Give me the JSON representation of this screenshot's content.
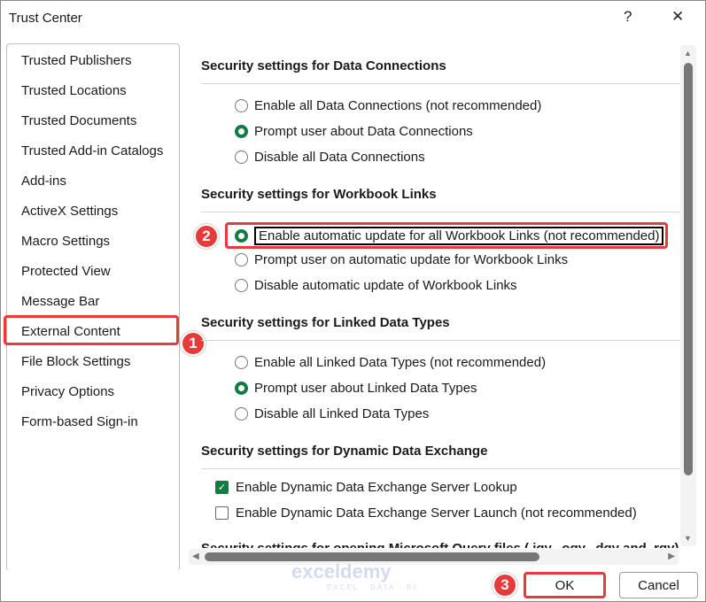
{
  "window": {
    "title": "Trust Center",
    "help": "?",
    "close": "✕"
  },
  "sidebar": {
    "items": [
      "Trusted Publishers",
      "Trusted Locations",
      "Trusted Documents",
      "Trusted Add-in Catalogs",
      "Add-ins",
      "ActiveX Settings",
      "Macro Settings",
      "Protected View",
      "Message Bar",
      "External Content",
      "File Block Settings",
      "Privacy Options",
      "Form-based Sign-in"
    ],
    "selected": "External Content"
  },
  "sections": {
    "data_connections": {
      "heading": "Security settings for Data Connections",
      "options": [
        "Enable all Data Connections (not recommended)",
        "Prompt user about Data Connections",
        "Disable all Data Connections"
      ],
      "selected": 1
    },
    "workbook_links": {
      "heading": "Security settings for Workbook Links",
      "options": [
        "Enable automatic update for all Workbook Links (not recommended)",
        "Prompt user on automatic update for Workbook Links",
        "Disable automatic update of Workbook Links"
      ],
      "selected": 0
    },
    "linked_data_types": {
      "heading": "Security settings for Linked Data Types",
      "options": [
        "Enable all Linked Data Types (not recommended)",
        "Prompt user about Linked Data Types",
        "Disable all Linked Data Types"
      ],
      "selected": 1
    },
    "dde": {
      "heading": "Security settings for Dynamic Data Exchange",
      "checkboxes": [
        {
          "label": "Enable Dynamic Data Exchange Server Lookup",
          "checked": true
        },
        {
          "label": "Enable Dynamic Data Exchange Server Launch (not recommended)",
          "checked": false
        }
      ]
    },
    "query_files": {
      "heading": "Security settings for opening Microsoft Query files (.iqy, .oqy, .dqy and .rqy)"
    }
  },
  "badges": [
    "1",
    "2",
    "3"
  ],
  "buttons": {
    "ok": "OK",
    "cancel": "Cancel"
  },
  "watermark": {
    "name": "exceldemy",
    "tagline": "EXCEL · DATA · BI"
  },
  "colors": {
    "accent": "#107c41",
    "highlight": "#e53b3b"
  }
}
